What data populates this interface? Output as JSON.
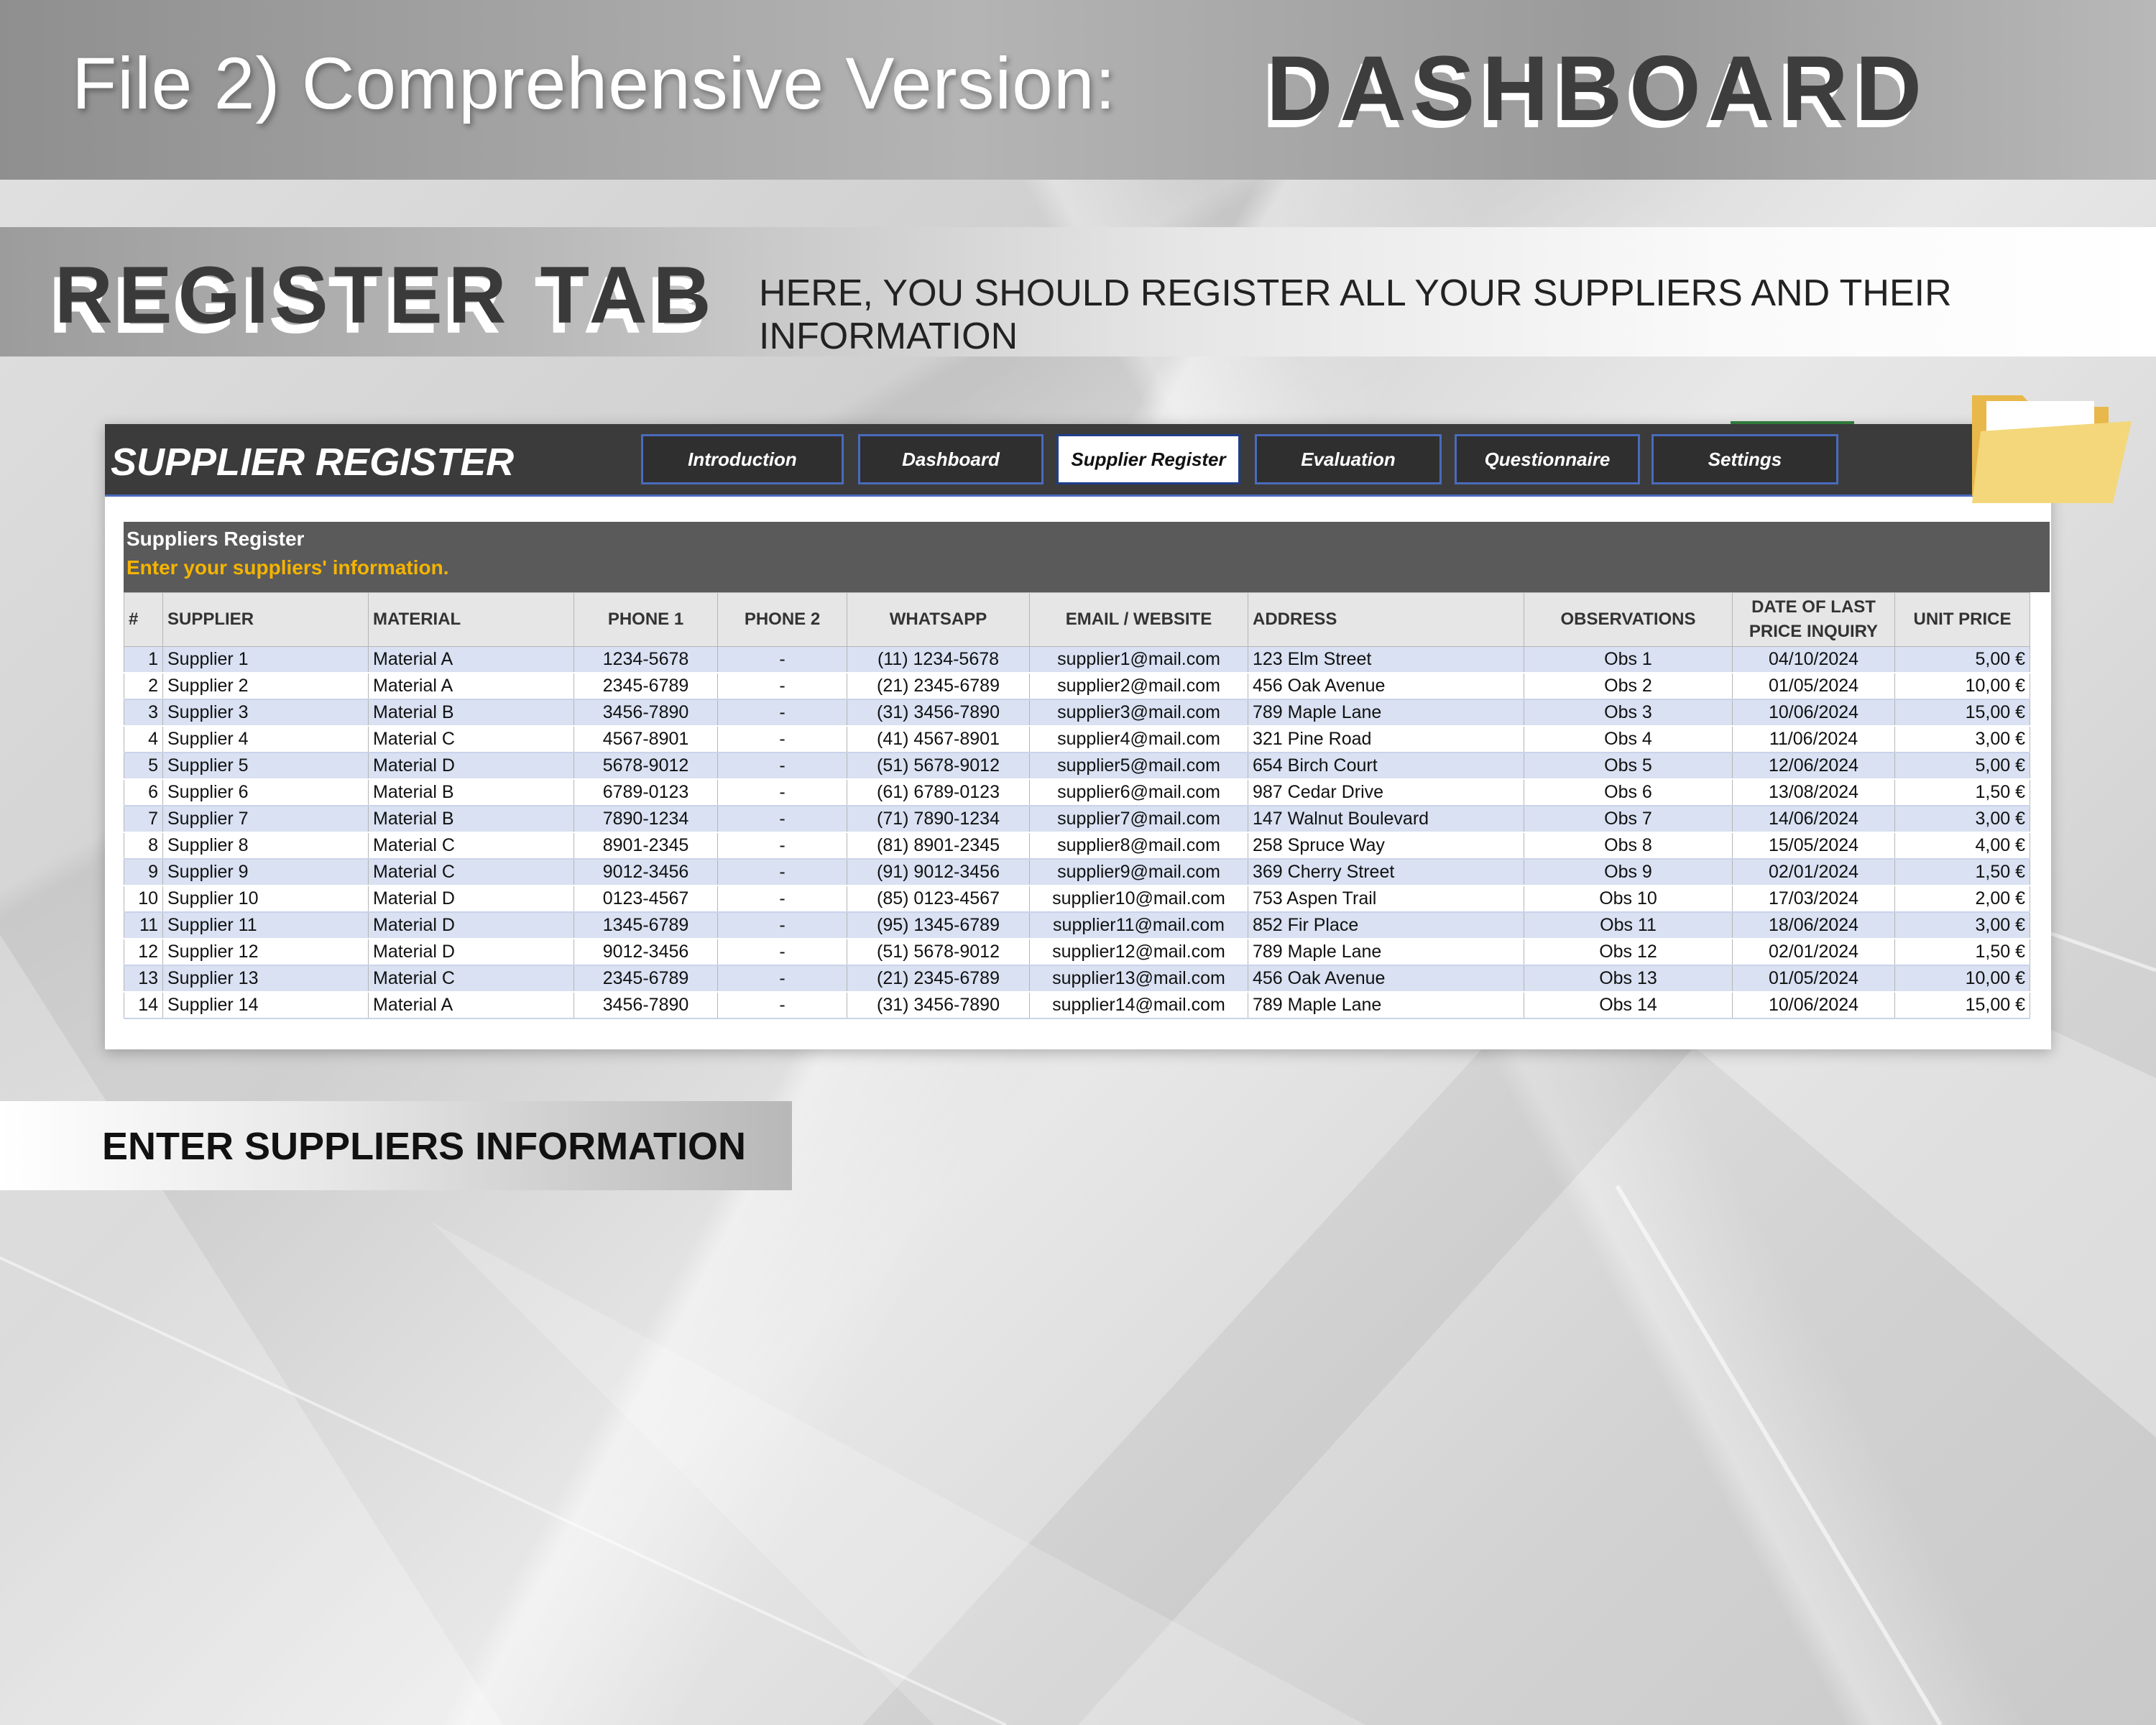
{
  "header": {
    "title": "File 2) Comprehensive Version:",
    "title_strong": "DASHBOARD"
  },
  "section": {
    "title": "REGISTER TAB",
    "description": "HERE, YOU SHOULD REGISTER ALL YOUR SUPPLIERS  AND THEIR INFORMATION"
  },
  "sheet": {
    "title": "SUPPLIER REGISTER",
    "nav": [
      {
        "label": "Introduction",
        "active": false
      },
      {
        "label": "Dashboard",
        "active": false
      },
      {
        "label": "Supplier Register",
        "active": true
      },
      {
        "label": "Evaluation",
        "active": false
      },
      {
        "label": "Questionnaire",
        "active": false
      },
      {
        "label": "Settings",
        "active": false
      }
    ],
    "block_title": "Suppliers Register",
    "block_subtitle": "Enter your suppliers' information.",
    "columns": [
      "#",
      "SUPPLIER",
      "MATERIAL",
      "PHONE 1",
      "PHONE 2",
      "WHATSAPP",
      "EMAIL / WEBSITE",
      "ADDRESS",
      "OBSERVATIONS",
      "DATE OF LAST PRICE INQUIRY",
      "UNIT PRICE"
    ],
    "rows": [
      [
        "1",
        "Supplier 1",
        "Material A",
        "1234-5678",
        "-",
        "(11) 1234-5678",
        "supplier1@mail.com",
        "123 Elm Street",
        "Obs 1",
        "04/10/2024",
        "5,00 €"
      ],
      [
        "2",
        "Supplier 2",
        "Material A",
        "2345-6789",
        "-",
        "(21) 2345-6789",
        "supplier2@mail.com",
        "456 Oak Avenue",
        "Obs 2",
        "01/05/2024",
        "10,00 €"
      ],
      [
        "3",
        "Supplier 3",
        "Material B",
        "3456-7890",
        "-",
        "(31) 3456-7890",
        "supplier3@mail.com",
        "789 Maple Lane",
        "Obs 3",
        "10/06/2024",
        "15,00 €"
      ],
      [
        "4",
        "Supplier 4",
        "Material C",
        "4567-8901",
        "-",
        "(41) 4567-8901",
        "supplier4@mail.com",
        "321 Pine Road",
        "Obs 4",
        "11/06/2024",
        "3,00 €"
      ],
      [
        "5",
        "Supplier 5",
        "Material D",
        "5678-9012",
        "-",
        "(51) 5678-9012",
        "supplier5@mail.com",
        "654 Birch Court",
        "Obs 5",
        "12/06/2024",
        "5,00 €"
      ],
      [
        "6",
        "Supplier 6",
        "Material B",
        "6789-0123",
        "-",
        "(61) 6789-0123",
        "supplier6@mail.com",
        "987 Cedar Drive",
        "Obs 6",
        "13/08/2024",
        "1,50 €"
      ],
      [
        "7",
        "Supplier 7",
        "Material B",
        "7890-1234",
        "-",
        "(71) 7890-1234",
        "supplier7@mail.com",
        "147 Walnut Boulevard",
        "Obs 7",
        "14/06/2024",
        "3,00 €"
      ],
      [
        "8",
        "Supplier 8",
        "Material C",
        "8901-2345",
        "-",
        "(81) 8901-2345",
        "supplier8@mail.com",
        "258 Spruce Way",
        "Obs 8",
        "15/05/2024",
        "4,00 €"
      ],
      [
        "9",
        "Supplier 9",
        "Material C",
        "9012-3456",
        "-",
        "(91) 9012-3456",
        "supplier9@mail.com",
        "369 Cherry Street",
        "Obs 9",
        "02/01/2024",
        "1,50 €"
      ],
      [
        "10",
        "Supplier 10",
        "Material D",
        "0123-4567",
        "-",
        "(85) 0123-4567",
        "supplier10@mail.com",
        "753 Aspen Trail",
        "Obs 10",
        "17/03/2024",
        "2,00 €"
      ],
      [
        "11",
        "Supplier 11",
        "Material D",
        "1345-6789",
        "-",
        "(95) 1345-6789",
        "supplier11@mail.com",
        "852 Fir Place",
        "Obs 11",
        "18/06/2024",
        "3,00 €"
      ],
      [
        "12",
        "Supplier 12",
        "Material D",
        "9012-3456",
        "-",
        "(51) 5678-9012",
        "supplier12@mail.com",
        "789 Maple Lane",
        "Obs 12",
        "02/01/2024",
        "1,50 €"
      ],
      [
        "13",
        "Supplier 13",
        "Material C",
        "2345-6789",
        "-",
        "(21) 2345-6789",
        "supplier13@mail.com",
        "456 Oak Avenue",
        "Obs 13",
        "01/05/2024",
        "10,00 €"
      ],
      [
        "14",
        "Supplier 14",
        "Material A",
        "3456-7890",
        "-",
        "(31) 3456-7890",
        "supplier14@mail.com",
        "789 Maple Lane",
        "Obs 14",
        "10/06/2024",
        "15,00 €"
      ]
    ]
  },
  "icons": {
    "folder": "folder-icon"
  },
  "footer_banner": {
    "text": "ENTER SUPPLIERS INFORMATION"
  },
  "colors": {
    "sheet_header": "#3b3b3b",
    "nav_border": "#4a6bbd",
    "block_bg": "#5a5a5a",
    "subtitle_accent": "#f5b400",
    "row_stripe": "#d9e1f2",
    "folder": "#f3d77a"
  }
}
